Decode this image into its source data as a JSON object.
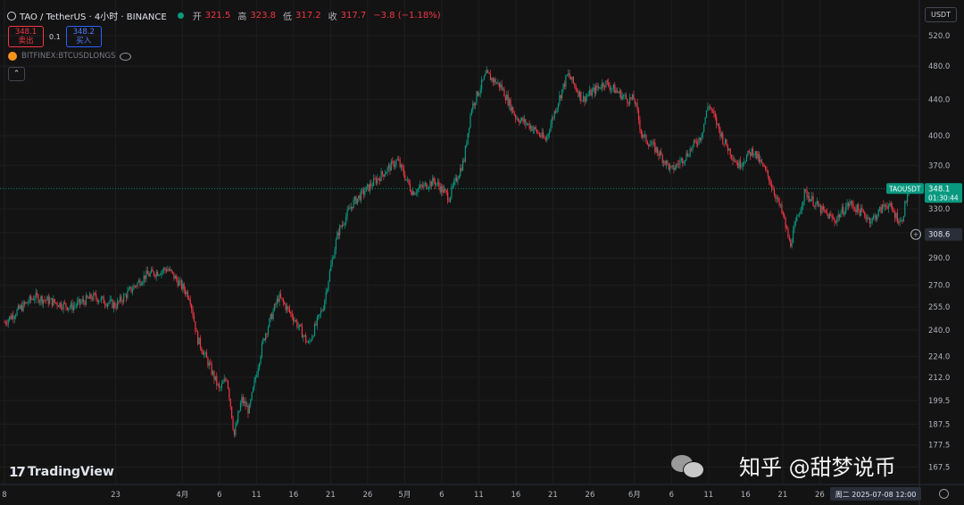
{
  "header": {
    "symbol": "TAO / TetherUS · 4小时 · BINANCE",
    "open_label": "开",
    "open": "321.5",
    "high_label": "高",
    "high": "323.8",
    "low_label": "低",
    "low": "317.2",
    "close_label": "收",
    "close": "317.7",
    "change": "−3.8 (−1.18%)"
  },
  "trade": {
    "sell_price": "348.1",
    "sell_label": "卖出",
    "spread": "0.1",
    "buy_price": "348.2",
    "buy_label": "买入"
  },
  "indicator": {
    "name": "BITFINEX:BTCUSDLONGS"
  },
  "currency_button": "USDT",
  "logo_text": "TradingView",
  "watermark": {
    "text": "知乎 @甜梦说币"
  },
  "colors": {
    "up": "#089981",
    "down": "#f23645",
    "background": "#131313",
    "grid": "#1f1f1f"
  },
  "chart_data": {
    "type": "candlestick",
    "symbol": "TAOUSDT",
    "price_axis": {
      "scale": "log",
      "ticks": [
        167.5,
        177.5,
        187.5,
        199.5,
        212.0,
        224.0,
        240.0,
        255.0,
        270.0,
        290.0,
        310.0,
        330.0,
        370.0,
        400.0,
        440.0,
        480.0,
        520.0
      ],
      "tick_labels": [
        "167.5",
        "177.5",
        "187.5",
        "199.5",
        "212.0",
        "224.0",
        "240.0",
        "255.0",
        "270.0",
        "290.0",
        "",
        "330.0",
        "370.0",
        "400.0",
        "440.0",
        "480.0",
        "520.0"
      ],
      "range": [
        160,
        545
      ]
    },
    "time_axis": {
      "start": "2025-03-08",
      "end": "2025-07-08",
      "ticks": [
        {
          "date": "2025-03-08",
          "label": "8"
        },
        {
          "date": "2025-03-23",
          "label": "23"
        },
        {
          "date": "2025-04-01",
          "label": "4月"
        },
        {
          "date": "2025-04-06",
          "label": "6"
        },
        {
          "date": "2025-04-11",
          "label": "11"
        },
        {
          "date": "2025-04-16",
          "label": "16"
        },
        {
          "date": "2025-04-21",
          "label": "21"
        },
        {
          "date": "2025-04-26",
          "label": "26"
        },
        {
          "date": "2025-05-01",
          "label": "5月"
        },
        {
          "date": "2025-05-06",
          "label": "6"
        },
        {
          "date": "2025-05-11",
          "label": "11"
        },
        {
          "date": "2025-05-16",
          "label": "16"
        },
        {
          "date": "2025-05-21",
          "label": "21"
        },
        {
          "date": "2025-05-26",
          "label": "26"
        },
        {
          "date": "2025-06-01",
          "label": "6月"
        },
        {
          "date": "2025-06-06",
          "label": "6"
        },
        {
          "date": "2025-06-11",
          "label": "11"
        },
        {
          "date": "2025-06-16",
          "label": "16"
        },
        {
          "date": "2025-06-21",
          "label": "21"
        },
        {
          "date": "2025-06-26",
          "label": "26"
        }
      ],
      "crosshair_label": "周二 2025-07-08   12:00"
    },
    "path": [
      [
        "2025-03-08",
        245
      ],
      [
        "2025-03-12",
        262
      ],
      [
        "2025-03-17",
        255
      ],
      [
        "2025-03-20",
        262
      ],
      [
        "2025-03-23",
        256
      ],
      [
        "2025-03-27",
        277
      ],
      [
        "2025-03-30",
        282
      ],
      [
        "2025-04-02",
        262
      ],
      [
        "2025-04-03",
        235
      ],
      [
        "2025-04-05",
        215
      ],
      [
        "2025-04-06",
        205
      ],
      [
        "2025-04-07",
        212
      ],
      [
        "2025-04-08",
        182
      ],
      [
        "2025-04-09",
        200
      ],
      [
        "2025-04-10",
        194
      ],
      [
        "2025-04-12",
        235
      ],
      [
        "2025-04-14",
        262
      ],
      [
        "2025-04-16",
        248
      ],
      [
        "2025-04-18",
        231
      ],
      [
        "2025-04-20",
        255
      ],
      [
        "2025-04-22",
        310
      ],
      [
        "2025-04-24",
        335
      ],
      [
        "2025-04-27",
        355
      ],
      [
        "2025-04-30",
        375
      ],
      [
        "2025-05-02",
        345
      ],
      [
        "2025-05-05",
        355
      ],
      [
        "2025-05-07",
        340
      ],
      [
        "2025-05-09",
        375
      ],
      [
        "2025-05-10",
        430
      ],
      [
        "2025-05-12",
        470
      ],
      [
        "2025-05-14",
        455
      ],
      [
        "2025-05-16",
        420
      ],
      [
        "2025-05-18",
        410
      ],
      [
        "2025-05-20",
        395
      ],
      [
        "2025-05-23",
        470
      ],
      [
        "2025-05-25",
        440
      ],
      [
        "2025-05-28",
        460
      ],
      [
        "2025-05-31",
        440
      ],
      [
        "2025-06-01",
        440
      ],
      [
        "2025-06-02",
        400
      ],
      [
        "2025-06-04",
        385
      ],
      [
        "2025-06-06",
        365
      ],
      [
        "2025-06-08",
        380
      ],
      [
        "2025-06-10",
        400
      ],
      [
        "2025-06-11",
        435
      ],
      [
        "2025-06-13",
        395
      ],
      [
        "2025-06-15",
        370
      ],
      [
        "2025-06-17",
        385
      ],
      [
        "2025-06-19",
        360
      ],
      [
        "2025-06-21",
        325
      ],
      [
        "2025-06-22",
        300
      ],
      [
        "2025-06-24",
        345
      ],
      [
        "2025-06-26",
        330
      ],
      [
        "2025-06-28",
        320
      ],
      [
        "2025-06-30",
        335
      ],
      [
        "2025-07-01",
        330
      ],
      [
        "2025-07-03",
        320
      ],
      [
        "2025-07-05",
        335
      ],
      [
        "2025-07-07",
        318
      ],
      [
        "2025-07-08",
        348.1
      ]
    ],
    "annotations": {
      "current_price": {
        "label": "TAOUSDT",
        "price": 348.1,
        "price_label": "348.1",
        "countdown": "01:30:44"
      },
      "crosshair_price": {
        "price": 308.6,
        "price_label": "308.6"
      }
    }
  }
}
